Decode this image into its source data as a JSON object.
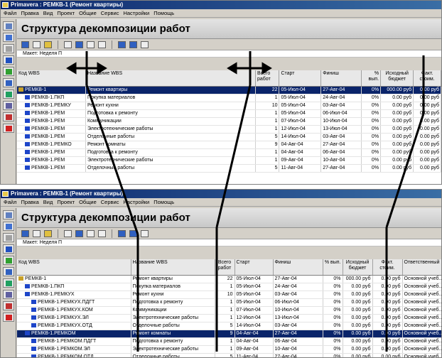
{
  "app": {
    "window_title": "Primavera : РЕМКВ-1 (Ремонт квартиры)",
    "menu": [
      "Файл",
      "Правка",
      "Вид",
      "Проект",
      "Общие",
      "Сервис",
      "Настройки",
      "Помощь"
    ],
    "page_title": "Структура декомпозиции работ",
    "layout_label": "Макет: Неделя П"
  },
  "top": {
    "columns": [
      "Код WBS",
      "Название WBS",
      "Всего работ",
      "Старт",
      "Финиш",
      "% вып.",
      "Исходный бюджет",
      "Факт. стоим."
    ],
    "rows": [
      {
        "code": "РЕМКВ-1",
        "name": "Ремонт квартиры",
        "total": "22",
        "start": "05-Июл-04",
        "finish": "27-Авг-04",
        "pct": "0%",
        "budget": "000.00 руб",
        "actual": "0.00 руб",
        "selected": true
      },
      {
        "code": "РЕМКВ-1.ПКП",
        "name": "Покупка материалов",
        "total": "1",
        "start": "05-Июл-04",
        "finish": "24-Авг-04",
        "pct": "0%",
        "budget": "0.00 руб",
        "actual": "0.00 руб"
      },
      {
        "code": "РЕМКВ-1.РЕМКУ",
        "name": "Ремонт кухни",
        "total": "10",
        "start": "05-Июл-04",
        "finish": "03-Авг-04",
        "pct": "0%",
        "budget": "0.00 руб",
        "actual": "0.00 руб"
      },
      {
        "code": "РЕМКВ-1.РЕМ",
        "name": "Подготовка к ремонту",
        "total": "1",
        "start": "05-Июл-04",
        "finish": "06-Июл-04",
        "pct": "0%",
        "budget": "0.00 руб",
        "actual": "0.00 руб"
      },
      {
        "code": "РЕМКВ-1.РЕМ",
        "name": "Коммуникации",
        "total": "1",
        "start": "07-Июл-04",
        "finish": "10-Июл-04",
        "pct": "0%",
        "budget": "0.00 руб",
        "actual": "0.00 руб"
      },
      {
        "code": "РЕМКВ-1.РЕМ",
        "name": "Электротехнические работы",
        "total": "1",
        "start": "12-Июл-04",
        "finish": "13-Июл-04",
        "pct": "0%",
        "budget": "0.00 руб",
        "actual": "0.00 руб"
      },
      {
        "code": "РЕМКВ-1.РЕМ",
        "name": "Отделочные работы",
        "total": "5",
        "start": "14-Июл-04",
        "finish": "03-Авг-04",
        "pct": "0%",
        "budget": "0.00 руб",
        "actual": "0.00 руб"
      },
      {
        "code": "РЕМКВ-1.РЕМКО",
        "name": "Ремонт комнаты",
        "total": "9",
        "start": "04-Авг-04",
        "finish": "27-Авг-04",
        "pct": "0%",
        "budget": "0.00 руб",
        "actual": "0.00 руб"
      },
      {
        "code": "РЕМКВ-1.РЕМ",
        "name": "Подготовка к ремонту",
        "total": "1",
        "start": "04-Авг-04",
        "finish": "06-Авг-04",
        "pct": "0%",
        "budget": "0.00 руб",
        "actual": "0.00 руб"
      },
      {
        "code": "РЕМКВ-1.РЕМ",
        "name": "Электротехнические работы",
        "total": "1",
        "start": "09-Авг-04",
        "finish": "10-Авг-04",
        "pct": "0%",
        "budget": "0.00 руб",
        "actual": "0.00 руб"
      },
      {
        "code": "РЕМКВ-1.РЕМ",
        "name": "Отделочные работы",
        "total": "5",
        "start": "11-Авг-04",
        "finish": "27-Авг-04",
        "pct": "0%",
        "budget": "0.00 руб",
        "actual": "0.00 руб"
      }
    ]
  },
  "bottom": {
    "columns": [
      "Код WBS",
      "Название WBS",
      "Всего работ",
      "Старт",
      "Финиш",
      "% вып.",
      "Исходный бюджет",
      "Факт. стоим.",
      "Ответственный"
    ],
    "rows": [
      {
        "code": "РЕМКВ-1",
        "name": "Ремонт квартиры",
        "total": "22",
        "start": "05-Июл-04",
        "finish": "27-Авг-04",
        "pct": "0%",
        "budget": "000.00 руб",
        "actual": "0.00 руб",
        "resp": "Основной учеб..."
      },
      {
        "code": "РЕМКВ-1.ПКП",
        "name": "Покупка материалов",
        "total": "1",
        "start": "05-Июл-04",
        "finish": "24-Авг-04",
        "pct": "0%",
        "budget": "0.00 руб",
        "actual": "0.00 руб",
        "resp": "Основной учеб..."
      },
      {
        "code": "РЕМКВ-1.РЕМКУХ",
        "name": "Ремонт кухни",
        "total": "10",
        "start": "05-Июл-04",
        "finish": "03-Авг-04",
        "pct": "0%",
        "budget": "0.00 руб",
        "actual": "0.00 руб",
        "resp": "Основной учеб..."
      },
      {
        "code": "РЕМКВ-1.РЕМКУХ.ПДГТ",
        "name": "Подготовка к ремонту",
        "total": "1",
        "start": "05-Июл-04",
        "finish": "06-Июл-04",
        "pct": "0%",
        "budget": "0.00 руб",
        "actual": "0.00 руб",
        "resp": "Основной учеб..."
      },
      {
        "code": "РЕМКВ-1.РЕМКУХ.КОМ",
        "name": "Коммуникации",
        "total": "1",
        "start": "07-Июл-04",
        "finish": "10-Июл-04",
        "pct": "0%",
        "budget": "0.00 руб",
        "actual": "0.00 руб",
        "resp": "Основной учеб..."
      },
      {
        "code": "РЕМКВ-1.РЕМКУХ.ЭЛ",
        "name": "Электротехнические работы",
        "total": "1",
        "start": "12-Июл-04",
        "finish": "13-Июл-04",
        "pct": "0%",
        "budget": "0.00 руб",
        "actual": "0.00 руб",
        "resp": "Основной учеб..."
      },
      {
        "code": "РЕМКВ-1.РЕМКУХ.ОТД",
        "name": "Отделочные работы",
        "total": "5",
        "start": "14-Июл-04",
        "finish": "03-Авг-04",
        "pct": "0%",
        "budget": "0.00 руб",
        "actual": "0.00 руб",
        "resp": "Основной учеб..."
      },
      {
        "code": "РЕМКВ-1.РЕМКОМ",
        "name": "Ремонт комнаты",
        "total": "9",
        "start": "04-Авг-04",
        "finish": "27-Авг-04",
        "pct": "0%",
        "budget": "0.00 руб",
        "actual": "0.00 руб",
        "resp": "Основной учеб...",
        "selected": true
      },
      {
        "code": "РЕМКВ-1.РЕМКОМ.ПДГТ",
        "name": "Подготовка к ремонту",
        "total": "1",
        "start": "04-Авг-04",
        "finish": "06-Авг-04",
        "pct": "0%",
        "budget": "0.00 руб",
        "actual": "0.00 руб",
        "resp": "Основной учеб..."
      },
      {
        "code": "РЕМКВ-1.РЕМКОМ.ЭЛ",
        "name": "Электротехнические работы",
        "total": "1",
        "start": "09-Авг-04",
        "finish": "10-Авг-04",
        "pct": "0%",
        "budget": "0.00 руб",
        "actual": "0.00 руб",
        "resp": "Основной учеб..."
      },
      {
        "code": "РЕМКВ-1.РЕМКОМ.ОТД",
        "name": "Отделочные работы",
        "total": "5",
        "start": "11-Авг-04",
        "finish": "27-Авг-04",
        "pct": "0%",
        "budget": "0.00 руб",
        "actual": "0.00 руб",
        "resp": "Основной учеб..."
      }
    ]
  }
}
